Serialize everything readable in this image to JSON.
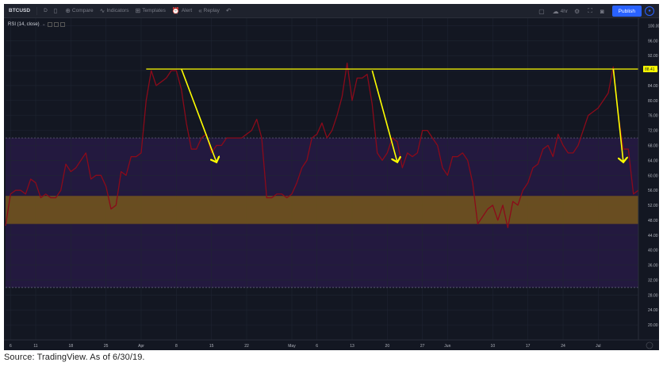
{
  "toolbar": {
    "symbol": "BTCUSD",
    "interval": "D",
    "compare": "Compare",
    "indicators": "Indicators",
    "templates": "Templates",
    "alert": "Alert",
    "replay": "Replay",
    "layout": "4hr",
    "publish": "Publish"
  },
  "indicator_label": "RSI (14, close)",
  "source": "Source:  TradingView.  As  of  6/30/19.",
  "colors": {
    "background": "#131722",
    "rsi_line": "#8b0a1a",
    "resistance": "#ffff00",
    "arrows": "#ffff00",
    "overbought_band": "#2a1b4a",
    "support_band": "#7a5a1a",
    "price_label_bg": "#ffff00"
  },
  "chart_data": {
    "type": "line",
    "title": "",
    "xlabel": "",
    "ylabel": "",
    "ylim": [
      16,
      102
    ],
    "y_ticks": [
      "100.00",
      "96.00",
      "92.00",
      "88.00",
      "84.00",
      "80.00",
      "76.00",
      "72.00",
      "68.00",
      "64.00",
      "60.00",
      "56.00",
      "52.00",
      "48.00",
      "44.00",
      "40.00",
      "36.00",
      "32.00",
      "28.00",
      "24.00",
      "20.00"
    ],
    "x_ticks": [
      {
        "label": "6",
        "i": 1
      },
      {
        "label": "11",
        "i": 6
      },
      {
        "label": "18",
        "i": 13
      },
      {
        "label": "25",
        "i": 20
      },
      {
        "label": "Apr",
        "i": 27
      },
      {
        "label": "8",
        "i": 34
      },
      {
        "label": "15",
        "i": 41
      },
      {
        "label": "22",
        "i": 48
      },
      {
        "label": "May",
        "i": 57
      },
      {
        "label": "6",
        "i": 62
      },
      {
        "label": "13",
        "i": 69
      },
      {
        "label": "20",
        "i": 76
      },
      {
        "label": "27",
        "i": 83
      },
      {
        "label": "Jun",
        "i": 88
      },
      {
        "label": "10",
        "i": 97
      },
      {
        "label": "17",
        "i": 104
      },
      {
        "label": "24",
        "i": 111
      },
      {
        "label": "Jul",
        "i": 118
      }
    ],
    "series": [
      {
        "values": [
          46.5,
          55,
          56,
          56,
          55,
          59,
          58,
          54,
          55,
          54,
          54,
          56,
          63,
          61,
          62,
          64,
          66,
          59,
          60,
          60,
          57,
          51,
          52,
          61,
          60,
          65,
          65,
          66,
          80,
          88,
          84,
          85,
          86,
          88,
          88,
          83,
          74,
          67,
          67,
          70,
          71,
          66,
          68,
          68,
          70,
          70,
          70,
          70,
          71,
          72,
          75,
          70,
          54,
          54,
          55,
          55,
          54,
          55,
          58,
          62,
          64,
          70,
          71,
          74,
          70,
          72,
          76,
          81,
          90,
          80,
          86,
          86,
          87,
          79,
          66,
          64,
          66,
          70,
          69,
          62,
          66,
          65,
          66,
          72,
          72,
          70,
          68,
          62,
          60,
          65,
          65,
          66,
          64,
          58,
          47,
          49,
          51,
          52,
          48,
          52,
          46,
          53,
          52,
          56,
          58,
          62,
          63,
          67,
          68,
          65,
          71,
          68,
          66,
          66,
          68,
          72,
          76,
          77,
          78,
          80,
          82,
          89,
          76,
          67,
          67,
          55,
          56
        ]
      }
    ],
    "current_value_label": "88.41",
    "resistance_level": 88.41,
    "bands": {
      "upper_dashed": 70,
      "lower_dashed": 30,
      "support_zone": [
        47,
        54.5
      ]
    },
    "annotations": [
      {
        "type": "arrow",
        "from": {
          "i": 35,
          "v": 88.5
        },
        "to": {
          "i": 42,
          "v": 63.5
        }
      },
      {
        "type": "arrow",
        "from": {
          "i": 73,
          "v": 88
        },
        "to": {
          "i": 78,
          "v": 63.5
        }
      },
      {
        "type": "arrow",
        "from": {
          "i": 121,
          "v": 88.5
        },
        "to": {
          "i": 123,
          "v": 63.5
        }
      }
    ],
    "resistance_start_i": 28,
    "grid": true
  }
}
